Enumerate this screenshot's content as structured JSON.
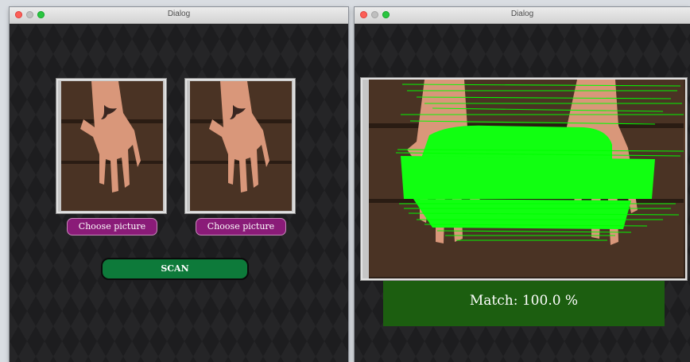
{
  "left_window": {
    "title": "Dialog",
    "buttons": {
      "choose_left": "Choose picture",
      "choose_right": "Choose picture",
      "scan": "SCAN"
    }
  },
  "right_window": {
    "title": "Dialog",
    "result_text": "Match: 100.0 %"
  },
  "colors": {
    "choose_button": "#8a1b78",
    "scan_button": "#0d7a3a",
    "match_lines": "#00ff00",
    "result_banner": "#1c5e10"
  },
  "icons": [
    "close-icon",
    "minimize-icon",
    "zoom-icon"
  ]
}
